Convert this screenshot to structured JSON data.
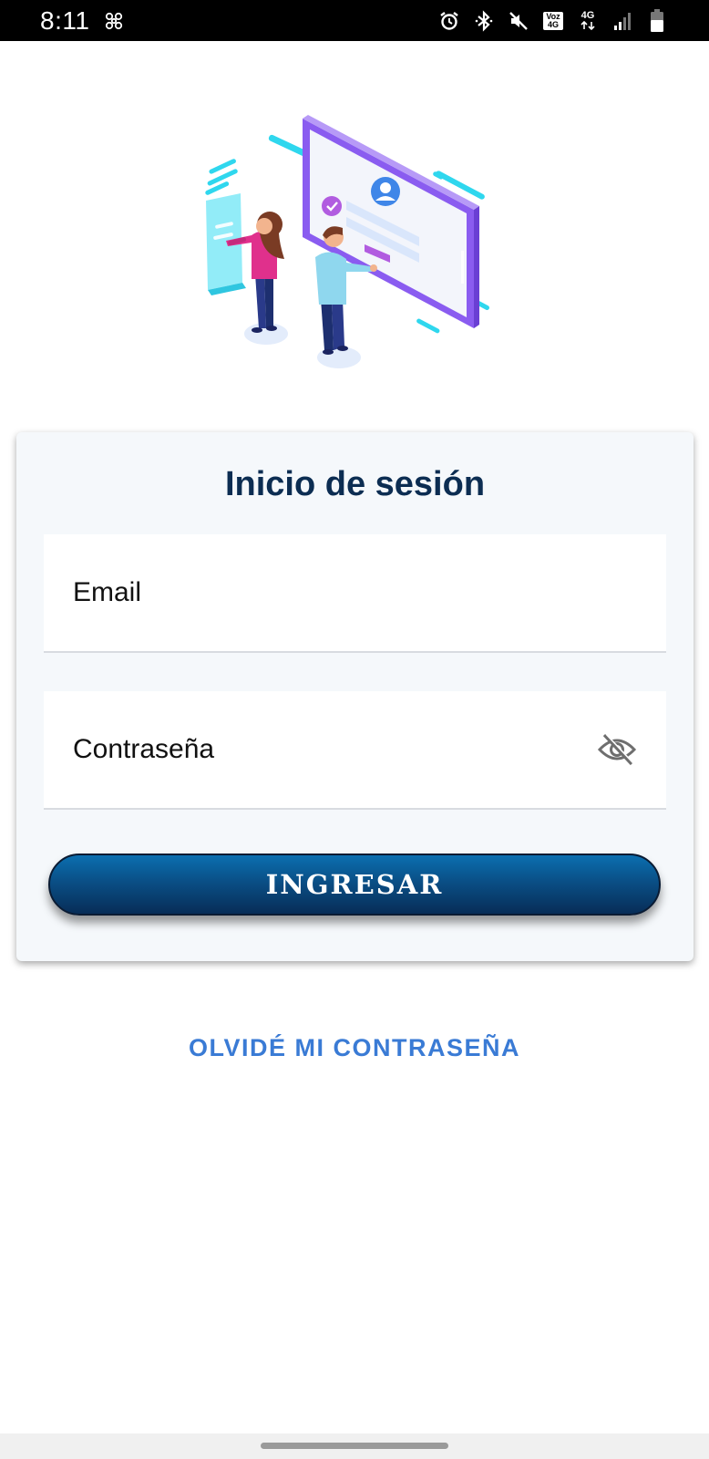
{
  "status_bar": {
    "time": "8:11",
    "icons": [
      "pinwheel-icon",
      "alarm-icon",
      "bluetooth-icon",
      "mute-icon",
      "volte-icon",
      "lte-icon",
      "signal-icon",
      "battery-icon"
    ],
    "network_badge_top": "Voz",
    "network_badge_bottom": "4G",
    "lte_label": "4G"
  },
  "illustration": {
    "description_icon": "people-login-screen-illustration",
    "colors": {
      "purple": "#8a5cf0",
      "cyan": "#2fd7ee",
      "pink": "#e0308c",
      "navy": "#1d2f6f"
    }
  },
  "login": {
    "title": "Inicio de sesión",
    "email_placeholder": "Email",
    "email_value": "",
    "password_placeholder": "Contraseña",
    "password_value": "",
    "password_toggle_icon": "eye-off-icon",
    "submit_label": "INGRESAR",
    "forgot_label": "OLVIDÉ MI CONTRASEÑA"
  },
  "colors": {
    "title": "#0c2d52",
    "button_top": "#0b6fb0",
    "button_bottom": "#072d57",
    "link": "#3a7bd5",
    "card_background": "#f5f8fb"
  }
}
